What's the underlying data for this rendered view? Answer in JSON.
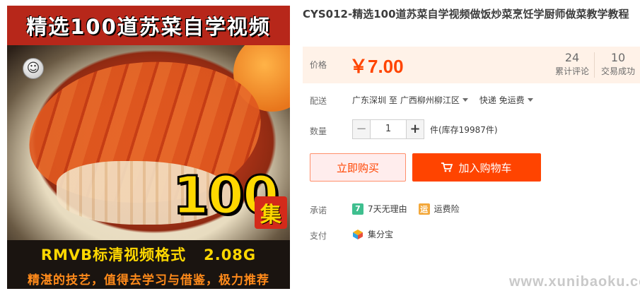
{
  "product_image": {
    "title_text": "精选100道苏菜自学视频",
    "count_badge": "100",
    "count_unit": "集",
    "format_text": "RMVB标清视频格式   2.08G",
    "slogan_text": "精湛的技艺，值得去学习与借鉴，极力推荐"
  },
  "product": {
    "title": "CYS012-精选100道苏菜自学视频做饭炒菜烹饪学厨师做菜教学教程"
  },
  "price": {
    "label": "价格",
    "value": "￥7.00",
    "reviews_count": "24",
    "reviews_label": "累计评论",
    "sales_count": "10",
    "sales_label": "交易成功"
  },
  "shipping": {
    "label": "配送",
    "from": "广东深圳 至",
    "to": "广西柳州柳江区",
    "method": "快递 免运费"
  },
  "quantity": {
    "label": "数量",
    "minus": "−",
    "value": "1",
    "plus": "+",
    "stock": "件(库存19987件)"
  },
  "actions": {
    "buy_now": "立即购买",
    "add_to_cart": "加入购物车"
  },
  "promise": {
    "label": "承诺",
    "items": [
      {
        "badge": "7",
        "text": "7天无理由"
      },
      {
        "badge": "运",
        "text": "运费险"
      }
    ]
  },
  "payment": {
    "label": "支付",
    "method": "集分宝"
  },
  "watermark": "www.xunibaoku.com",
  "colors": {
    "accent": "#ff4400",
    "price_bg": "#fff2e8"
  }
}
